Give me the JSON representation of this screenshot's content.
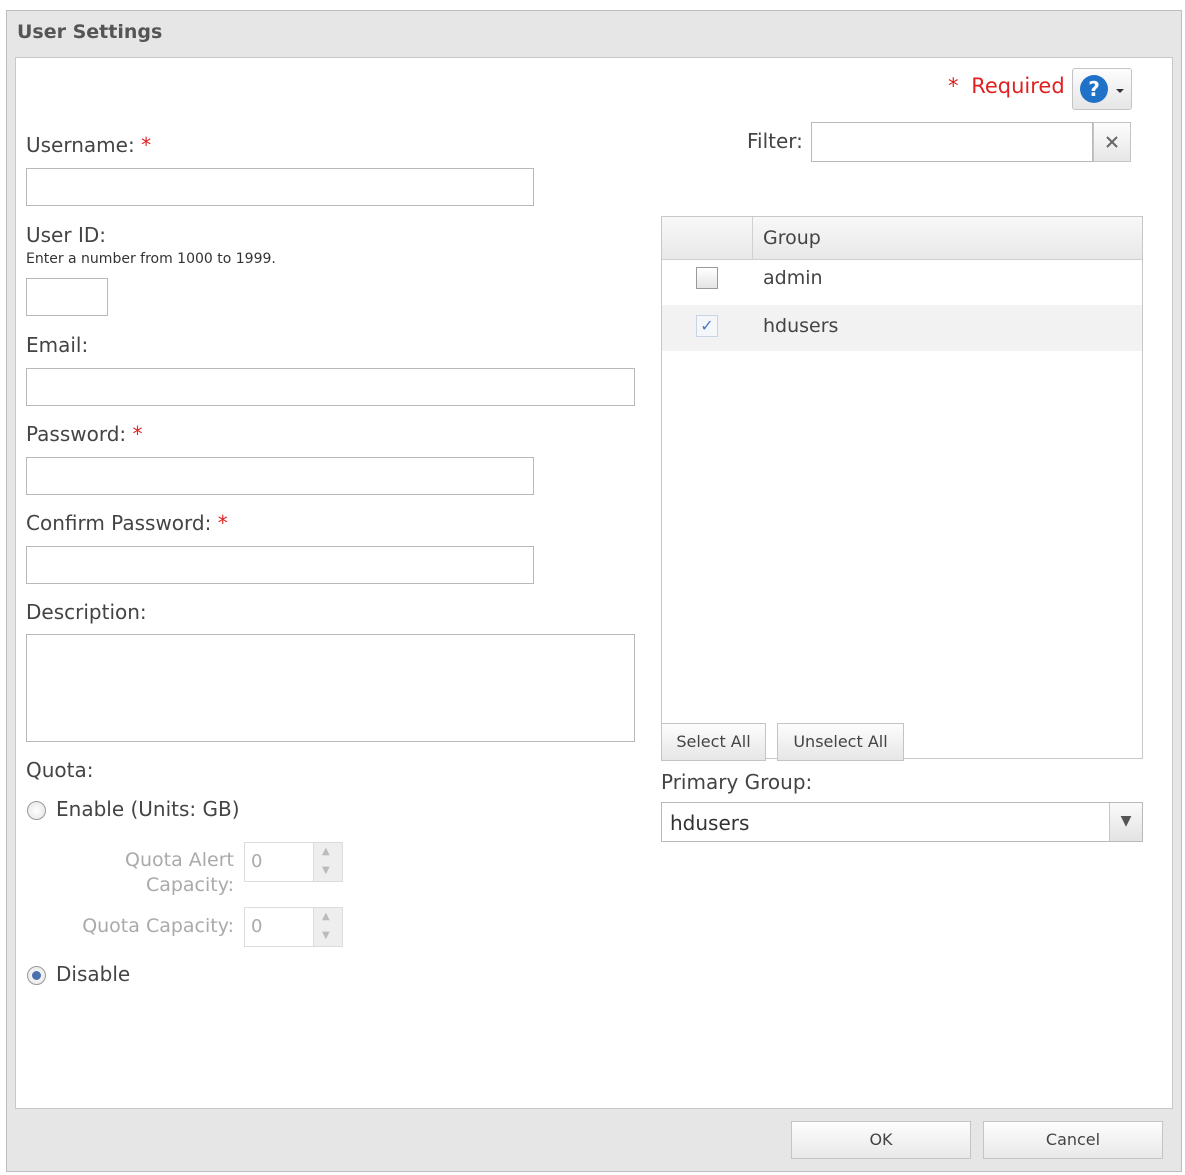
{
  "dialog": {
    "title": "User Settings",
    "required_star": "*",
    "required_label": "Required",
    "help_icon": "question-circle-icon"
  },
  "form": {
    "username_label": "Username:",
    "user_id_label": "User ID:",
    "user_id_hint": "Enter a number from 1000 to 1999.",
    "email_label": "Email:",
    "password_label": "Password:",
    "confirm_password_label": "Confirm Password:",
    "description_label": "Description:",
    "quota_label": "Quota:",
    "enable_label": "Enable (Units: GB)",
    "quota_alert_label_line1": "Quota Alert",
    "quota_alert_label_line2": "Capacity:",
    "quota_alert_value": "0",
    "quota_capacity_label": "Quota Capacity:",
    "quota_capacity_value": "0",
    "disable_label": "Disable",
    "quota_selected": "Disable"
  },
  "groups": {
    "filter_label": "Filter:",
    "clear_icon": "close-icon",
    "column_header": "Group",
    "items": [
      {
        "name": "admin",
        "checked": false
      },
      {
        "name": "hdusers",
        "checked": true
      }
    ],
    "select_all_label": "Select All",
    "unselect_all_label": "Unselect All",
    "primary_group_label": "Primary Group:",
    "primary_group_value": "hdusers"
  },
  "footer": {
    "ok_label": "OK",
    "cancel_label": "Cancel"
  }
}
